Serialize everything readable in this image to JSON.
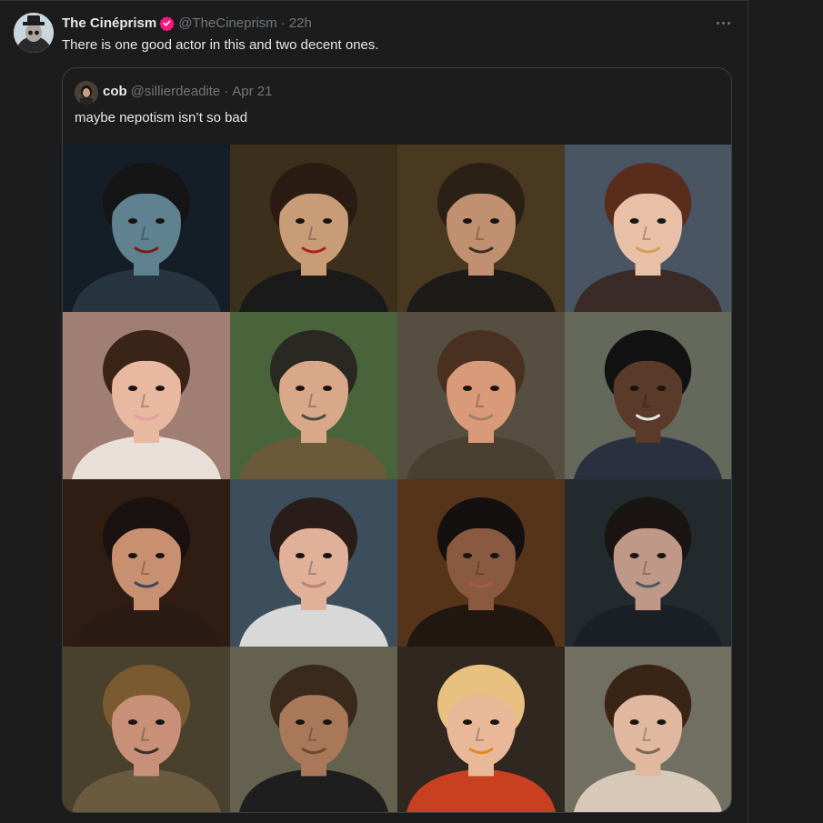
{
  "post": {
    "display_name": "The Cinéprism",
    "handle": "@TheCineprism",
    "separator": "·",
    "time": "22h",
    "text": "There is one good actor in this and two decent ones."
  },
  "quote": {
    "display_name": "cob",
    "handle": "@sillierdeadite",
    "separator": "·",
    "date": "Apr 21",
    "text": "maybe nepotism isn’t so bad"
  },
  "colors": {
    "background": "#1c1c1c",
    "text_primary": "#e7e9ea",
    "text_secondary": "#71767b",
    "verified_badge": "#f91880",
    "border": "#3a3f42"
  },
  "grid_photos": [
    {
      "bg": "#1a2530",
      "skin": "#5f8190",
      "hair": "#151515",
      "shirt": "#263540",
      "accent": "#7b1c1c"
    },
    {
      "bg": "#4a3a22",
      "skin": "#c99c78",
      "hair": "#2a1c12",
      "shirt": "#1a1a1a",
      "accent": "#b02020"
    },
    {
      "bg": "#5a4628",
      "skin": "#c09070",
      "hair": "#2a2016",
      "shirt": "#1e1a18",
      "accent": "#3a3026"
    },
    {
      "bg": "#5a6878",
      "skin": "#e8c0a8",
      "hair": "#5a2c1c",
      "shirt": "#3a2a28",
      "accent": "#d4a050"
    },
    {
      "bg": "#c49a8e",
      "skin": "#e8b8a0",
      "hair": "#3a2418",
      "shirt": "#e8e0d8",
      "accent": "#e0a0a0"
    },
    {
      "bg": "#5a7a48",
      "skin": "#d8a888",
      "hair": "#2a2822",
      "shirt": "#6a5a3a",
      "accent": "#4a4a40"
    },
    {
      "bg": "#6a6050",
      "skin": "#d89a78",
      "hair": "#4a3020",
      "shirt": "#4a4030",
      "accent": "#a08060"
    },
    {
      "bg": "#7a8070",
      "skin": "#5a3a28",
      "hair": "#121212",
      "shirt": "#2a3040",
      "accent": "#e8e8e8"
    },
    {
      "bg": "#3a2418",
      "skin": "#c89070",
      "hair": "#1a1210",
      "shirt": "#2a1c14",
      "accent": "#3a4858"
    },
    {
      "bg": "#4a6070",
      "skin": "#e0b098",
      "hair": "#2a1c18",
      "shirt": "#d8d8d8",
      "accent": "#c08078"
    },
    {
      "bg": "#6a4020",
      "skin": "#8a5a40",
      "hair": "#141010",
      "shirt": "#201810",
      "accent": "#a06040"
    },
    {
      "bg": "#2a3438",
      "skin": "#c09888",
      "hair": "#1a1412",
      "shirt": "#1a2026",
      "accent": "#4a5a60"
    },
    {
      "bg": "#5a5038",
      "skin": "#c89078",
      "hair": "#7a5a30",
      "shirt": "#6a5a40",
      "accent": "#3a3028"
    },
    {
      "bg": "#7a7860",
      "skin": "#a87858",
      "hair": "#3a2a1c",
      "shirt": "#1e1e1e",
      "accent": "#6a4a30"
    },
    {
      "bg": "#3a3028",
      "skin": "#e8b898",
      "hair": "#e8c080",
      "shirt": "#c84020",
      "accent": "#e08a20"
    },
    {
      "bg": "#8a8878",
      "skin": "#e0b8a0",
      "hair": "#3a2416",
      "shirt": "#d8c8b8",
      "accent": "#7a6a58"
    }
  ]
}
